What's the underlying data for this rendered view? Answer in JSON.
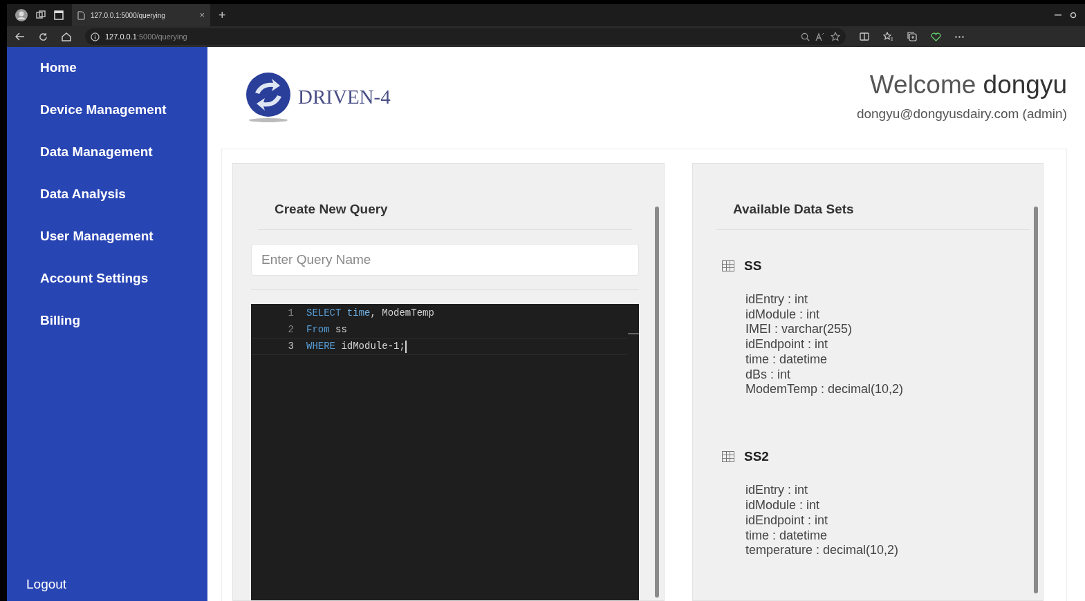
{
  "browser": {
    "tab_title": "127.0.0.1:5000/querying",
    "close_glyph": "×",
    "new_tab_glyph": "+",
    "url_host": "127.0.0.1",
    "url_path": ":5000/querying"
  },
  "sidebar": {
    "items": [
      {
        "label": "Home"
      },
      {
        "label": "Device Management"
      },
      {
        "label": "Data Management"
      },
      {
        "label": "Data Analysis"
      },
      {
        "label": "User Management"
      },
      {
        "label": "Account Settings"
      },
      {
        "label": "Billing"
      }
    ],
    "logout": "Logout"
  },
  "header": {
    "brand": "DRIVEN-4",
    "welcome": "Welcome",
    "username": "dongyu",
    "email_line": "dongyu@dongyusdairy.com (admin)"
  },
  "query_panel": {
    "title": "Create New Query",
    "name_placeholder": "Enter Query Name",
    "code_lines": [
      {
        "number": "1",
        "current": false,
        "tokens": [
          {
            "text": "SELECT",
            "kind": "keyword"
          },
          {
            "text": " time",
            "kind": "builtin"
          },
          {
            "text": ", ModemTemp",
            "kind": "plain"
          }
        ]
      },
      {
        "number": "2",
        "current": false,
        "tokens": [
          {
            "text": "From",
            "kind": "keyword"
          },
          {
            "text": " ss",
            "kind": "plain"
          }
        ]
      },
      {
        "number": "3",
        "current": true,
        "tokens": [
          {
            "text": "WHERE",
            "kind": "keyword"
          },
          {
            "text": " idModule-1;",
            "kind": "plain"
          }
        ]
      }
    ]
  },
  "datasets_panel": {
    "title": "Available Data Sets",
    "datasets": [
      {
        "name": "SS",
        "fields": [
          "idEntry : int",
          "idModule : int",
          "IMEI : varchar(255)",
          "idEndpoint : int",
          "time : datetime",
          "dBs : int",
          "ModemTemp : decimal(10,2)"
        ]
      },
      {
        "name": "SS2",
        "fields": [
          "idEntry : int",
          "idModule : int",
          "idEndpoint : int",
          "time : datetime",
          "temperature : decimal(10,2)"
        ]
      }
    ]
  }
}
